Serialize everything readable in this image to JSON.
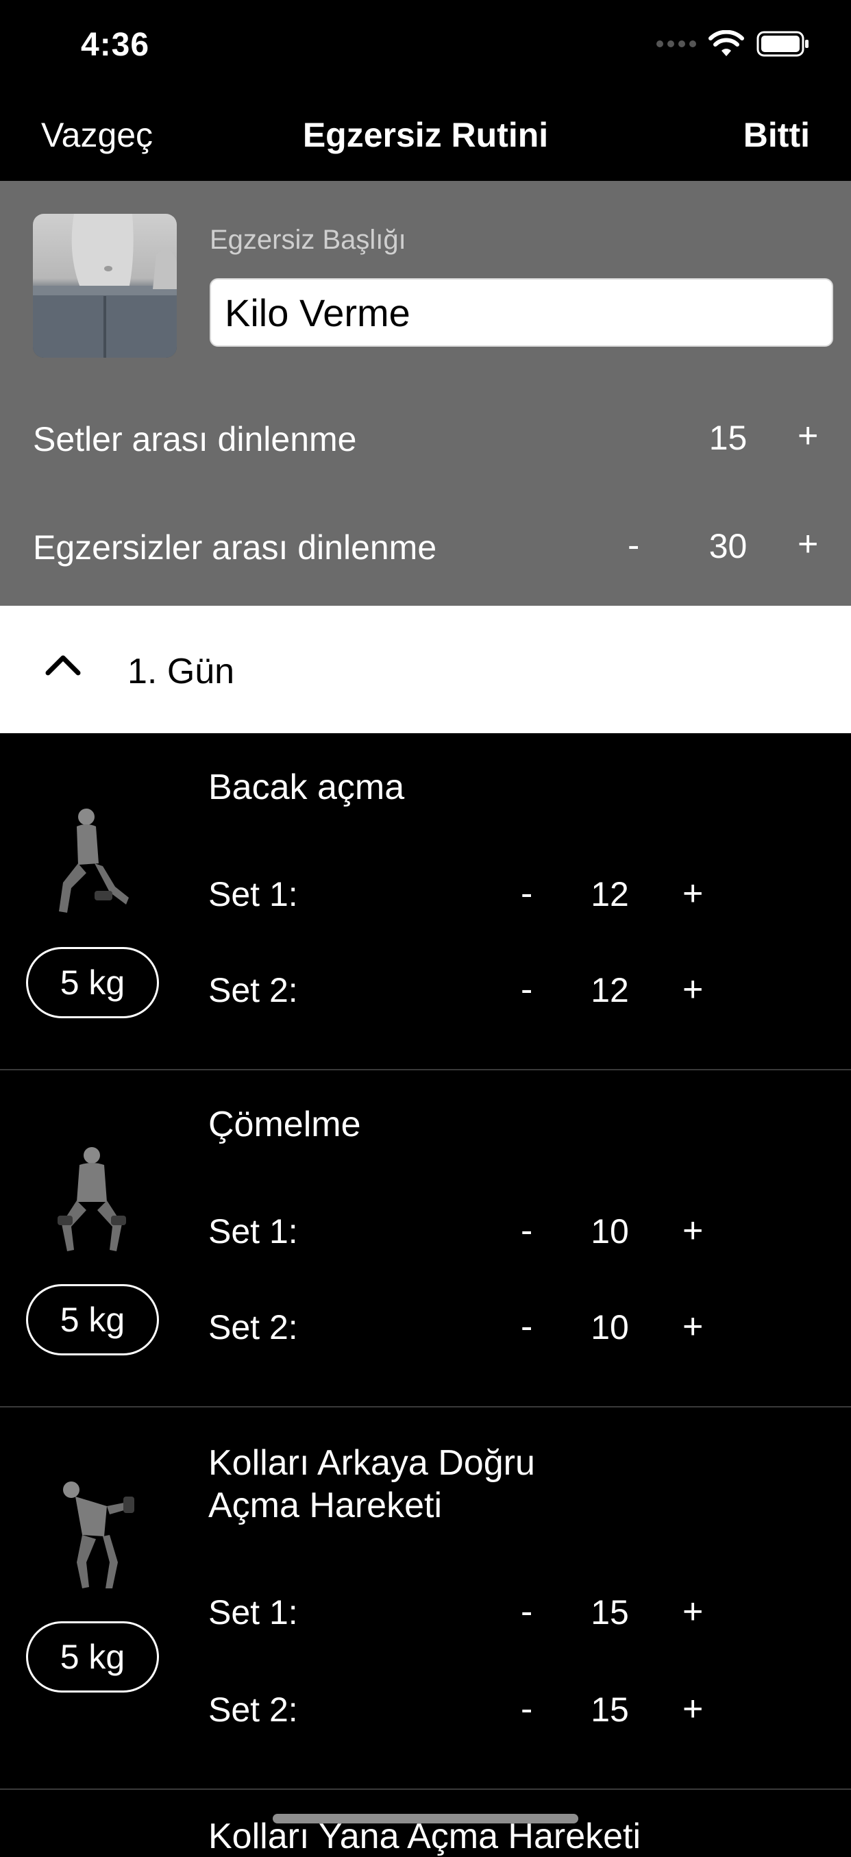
{
  "status": {
    "time": "4:36"
  },
  "nav": {
    "cancel": "Vazgeç",
    "title": "Egzersiz Rutini",
    "done": "Bitti"
  },
  "routine": {
    "title_label": "Egzersiz Başlığı",
    "title_value": "Kilo Verme",
    "rest_between_sets": {
      "label": "Setler arası dinlenme",
      "value": "15",
      "plus": "+"
    },
    "rest_between_exercises": {
      "label": "Egzersizler arası dinlenme",
      "minus": "-",
      "value": "30",
      "plus": "+"
    }
  },
  "day": {
    "label": "1. Gün"
  },
  "exercises": [
    {
      "name": "Bacak açma",
      "weight": "5 kg",
      "sets": [
        {
          "label": "Set 1:",
          "minus": "-",
          "value": "12",
          "plus": "+"
        },
        {
          "label": "Set 2:",
          "minus": "-",
          "value": "12",
          "plus": "+"
        }
      ]
    },
    {
      "name": "Çömelme",
      "weight": "5 kg",
      "sets": [
        {
          "label": "Set 1:",
          "minus": "-",
          "value": "10",
          "plus": "+"
        },
        {
          "label": "Set 2:",
          "minus": "-",
          "value": "10",
          "plus": "+"
        }
      ]
    },
    {
      "name_line1": "Kolları Arkaya Doğru",
      "name_line2": "Açma Hareketi",
      "weight": "5 kg",
      "sets": [
        {
          "label": "Set 1:",
          "minus": "-",
          "value": "15",
          "plus": "+"
        },
        {
          "label": "Set 2:",
          "minus": "-",
          "value": "15",
          "plus": "+"
        }
      ]
    }
  ],
  "next_exercise_partial": "Kolları Yana Açma Hareketi",
  "icons": {
    "signal": "cellular-signal-icon",
    "wifi": "wifi-icon",
    "battery": "battery-icon",
    "chevron": "chevron-up-icon"
  }
}
